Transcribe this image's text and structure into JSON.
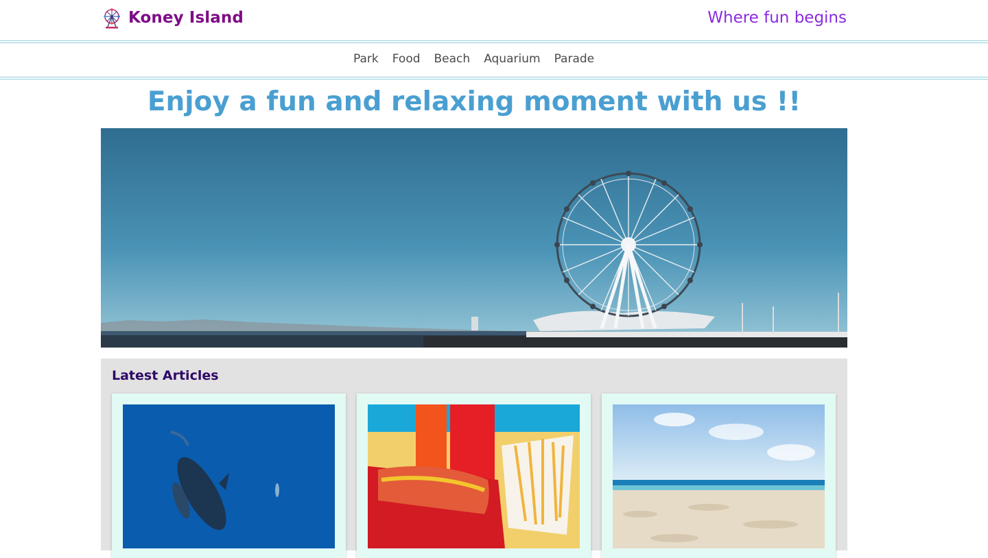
{
  "header": {
    "brand": "Koney Island",
    "tagline": "Where fun begins",
    "logo_icon": "ferris-wheel-icon"
  },
  "nav": {
    "items": [
      {
        "label": "Park"
      },
      {
        "label": "Food"
      },
      {
        "label": "Beach"
      },
      {
        "label": "Aquarium"
      },
      {
        "label": "Parade"
      }
    ]
  },
  "hero": {
    "title": "Enjoy a fun and relaxing moment with us !!",
    "image": "ferris-wheel-seaside-photo"
  },
  "articles": {
    "title": "Latest Articles",
    "cards": [
      {
        "image": "whale-ocean-photo"
      },
      {
        "image": "hotdog-fries-photo"
      },
      {
        "image": "sandy-beach-photo"
      }
    ]
  },
  "colors": {
    "brand": "#7e0d86",
    "tagline": "#8a2be2",
    "hero_title": "#4a9fd1",
    "articles_title": "#2e0a66",
    "card_bg": "#e2faf4",
    "articles_bg": "#e2e2e2"
  }
}
